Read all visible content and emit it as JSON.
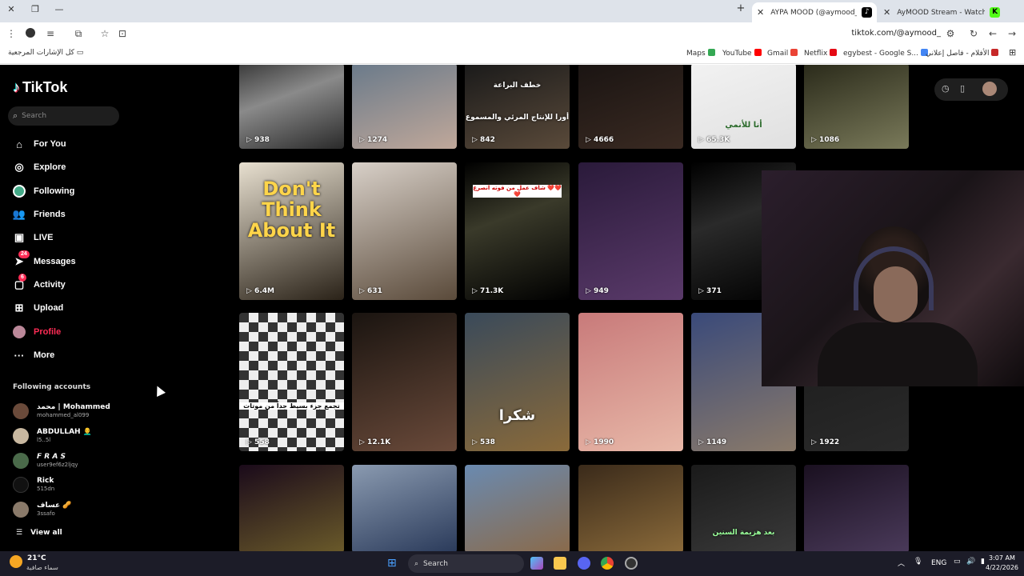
{
  "browser": {
    "tabs": [
      {
        "title": "AYPA MOOD (@aymood_) | TikTok",
        "active": true
      },
      {
        "title": "AyMOOD Stream - Watch Live on Kick",
        "active": false
      }
    ],
    "url": "tiktok.com/@aymood_",
    "bookmarks": {
      "all_bookmarks_label": "كل الإشارات المرجعية",
      "items": [
        "Maps",
        "YouTube",
        "Gmail",
        "Netflix",
        "egybest - Google S...",
        "الأفلام - فاصل إعلاني"
      ]
    }
  },
  "tiktok": {
    "logo": "TikTok",
    "search_placeholder": "Search",
    "nav": [
      {
        "label": "For You",
        "icon": "home-icon"
      },
      {
        "label": "Explore",
        "icon": "compass-icon"
      },
      {
        "label": "Following",
        "icon": "following-avatar-icon"
      },
      {
        "label": "Friends",
        "icon": "friends-icon"
      },
      {
        "label": "LIVE",
        "icon": "live-icon"
      },
      {
        "label": "Messages",
        "icon": "messages-icon",
        "badge": "24"
      },
      {
        "label": "Activity",
        "icon": "activity-icon",
        "badge": "6"
      },
      {
        "label": "Upload",
        "icon": "upload-icon"
      },
      {
        "label": "Profile",
        "icon": "profile-avatar-icon"
      },
      {
        "label": "More",
        "icon": "more-icon"
      }
    ],
    "following_title": "Following accounts",
    "accounts": [
      {
        "name": "محمد | Mohammed",
        "handle": "mohammed_al099"
      },
      {
        "name": "ABDULLAH 👨‍🦲",
        "handle": "l5..5l"
      },
      {
        "name": "𝙁 𝙍 𝘼 𝙎",
        "handle": "user9ef6z2ljqy"
      },
      {
        "name": "Rick",
        "handle": "515dn"
      },
      {
        "name": "عساف 🥜",
        "handle": "3ssafo"
      }
    ],
    "view_all": "View all"
  },
  "videos": [
    {
      "views": "938",
      "overlay": ""
    },
    {
      "views": "1274",
      "overlay": ""
    },
    {
      "views": "842",
      "overlay": "خطف البراعة\nأورا للإنتاج المرئي والمسموع"
    },
    {
      "views": "4666",
      "overlay": ""
    },
    {
      "views": "65.3K",
      "overlay": "أنا للأنمي"
    },
    {
      "views": "1086",
      "overlay": ""
    },
    {
      "views": "6.4M",
      "overlay": "Don't Think About It"
    },
    {
      "views": "631",
      "overlay": ""
    },
    {
      "views": "71.3K",
      "overlay": "شاف عمل من قوته انصرع ❤️❤️❤️"
    },
    {
      "views": "949",
      "overlay": ""
    },
    {
      "views": "371",
      "overlay": ""
    },
    {
      "views": "558",
      "overlay": "تجمع جزء بسيط جداً من موتات"
    },
    {
      "views": "12.1K",
      "overlay": ""
    },
    {
      "views": "538",
      "overlay": "شكرا"
    },
    {
      "views": "1990",
      "overlay": ""
    },
    {
      "views": "1149",
      "overlay": ""
    },
    {
      "views": "1922",
      "overlay": ""
    },
    {
      "views": "",
      "overlay": ""
    },
    {
      "views": "",
      "overlay": ""
    },
    {
      "views": "",
      "overlay": ""
    },
    {
      "views": "",
      "overlay": ""
    },
    {
      "views": "",
      "overlay": "بعد هزيمة السنين"
    },
    {
      "views": "",
      "overlay": ""
    }
  ],
  "taskbar": {
    "temperature": "21°C",
    "weather": "سماء صافية",
    "search_placeholder": "Search",
    "language": "ENG",
    "time": "3:07 AM",
    "date": "4/22/2026"
  }
}
